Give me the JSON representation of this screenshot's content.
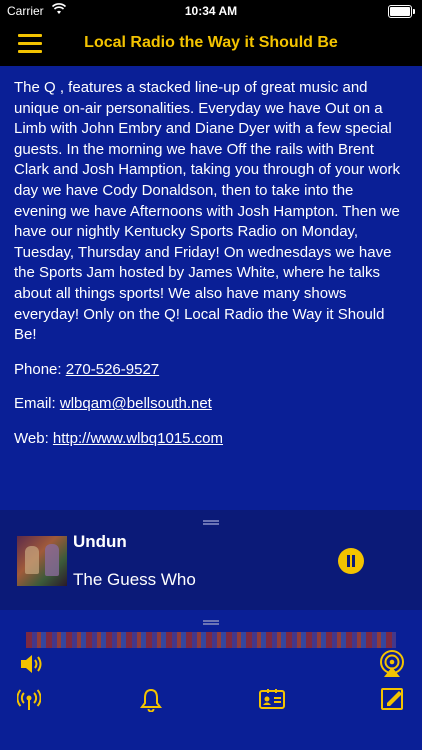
{
  "status": {
    "carrier": "Carrier",
    "time": "10:34 AM"
  },
  "nav": {
    "title": "Local Radio the Way it Should Be"
  },
  "content": {
    "description": "The Q , features a stacked line-up of great music and unique on-air personalities. Everyday we have Out on a Limb with John Embry and Diane Dyer with a few special guests. In the morning we have Off the rails with Brent Clark and Josh Hamption, taking you through of your work day we have Cody Donaldson, then to take into the evening we have Afternoons with Josh Hampton. Then we have our nightly Kentucky Sports Radio on Monday, Tuesday, Thursday and Friday! On wednesdays we have the Sports Jam hosted by James White, where he talks about all things sports! We also have many shows everyday! Only on the Q! Local Radio the Way it Should Be!",
    "phone_label": "Phone:",
    "phone": "270-526-9527",
    "email_label": "Email:",
    "email": "wlbqam@bellsouth.net",
    "web_label": "Web:",
    "web": "http://www.wlbq1015.com"
  },
  "player": {
    "song": "Undun",
    "artist": "The Guess Who",
    "state": "playing"
  },
  "icons": {
    "accent": "#f3c300"
  }
}
